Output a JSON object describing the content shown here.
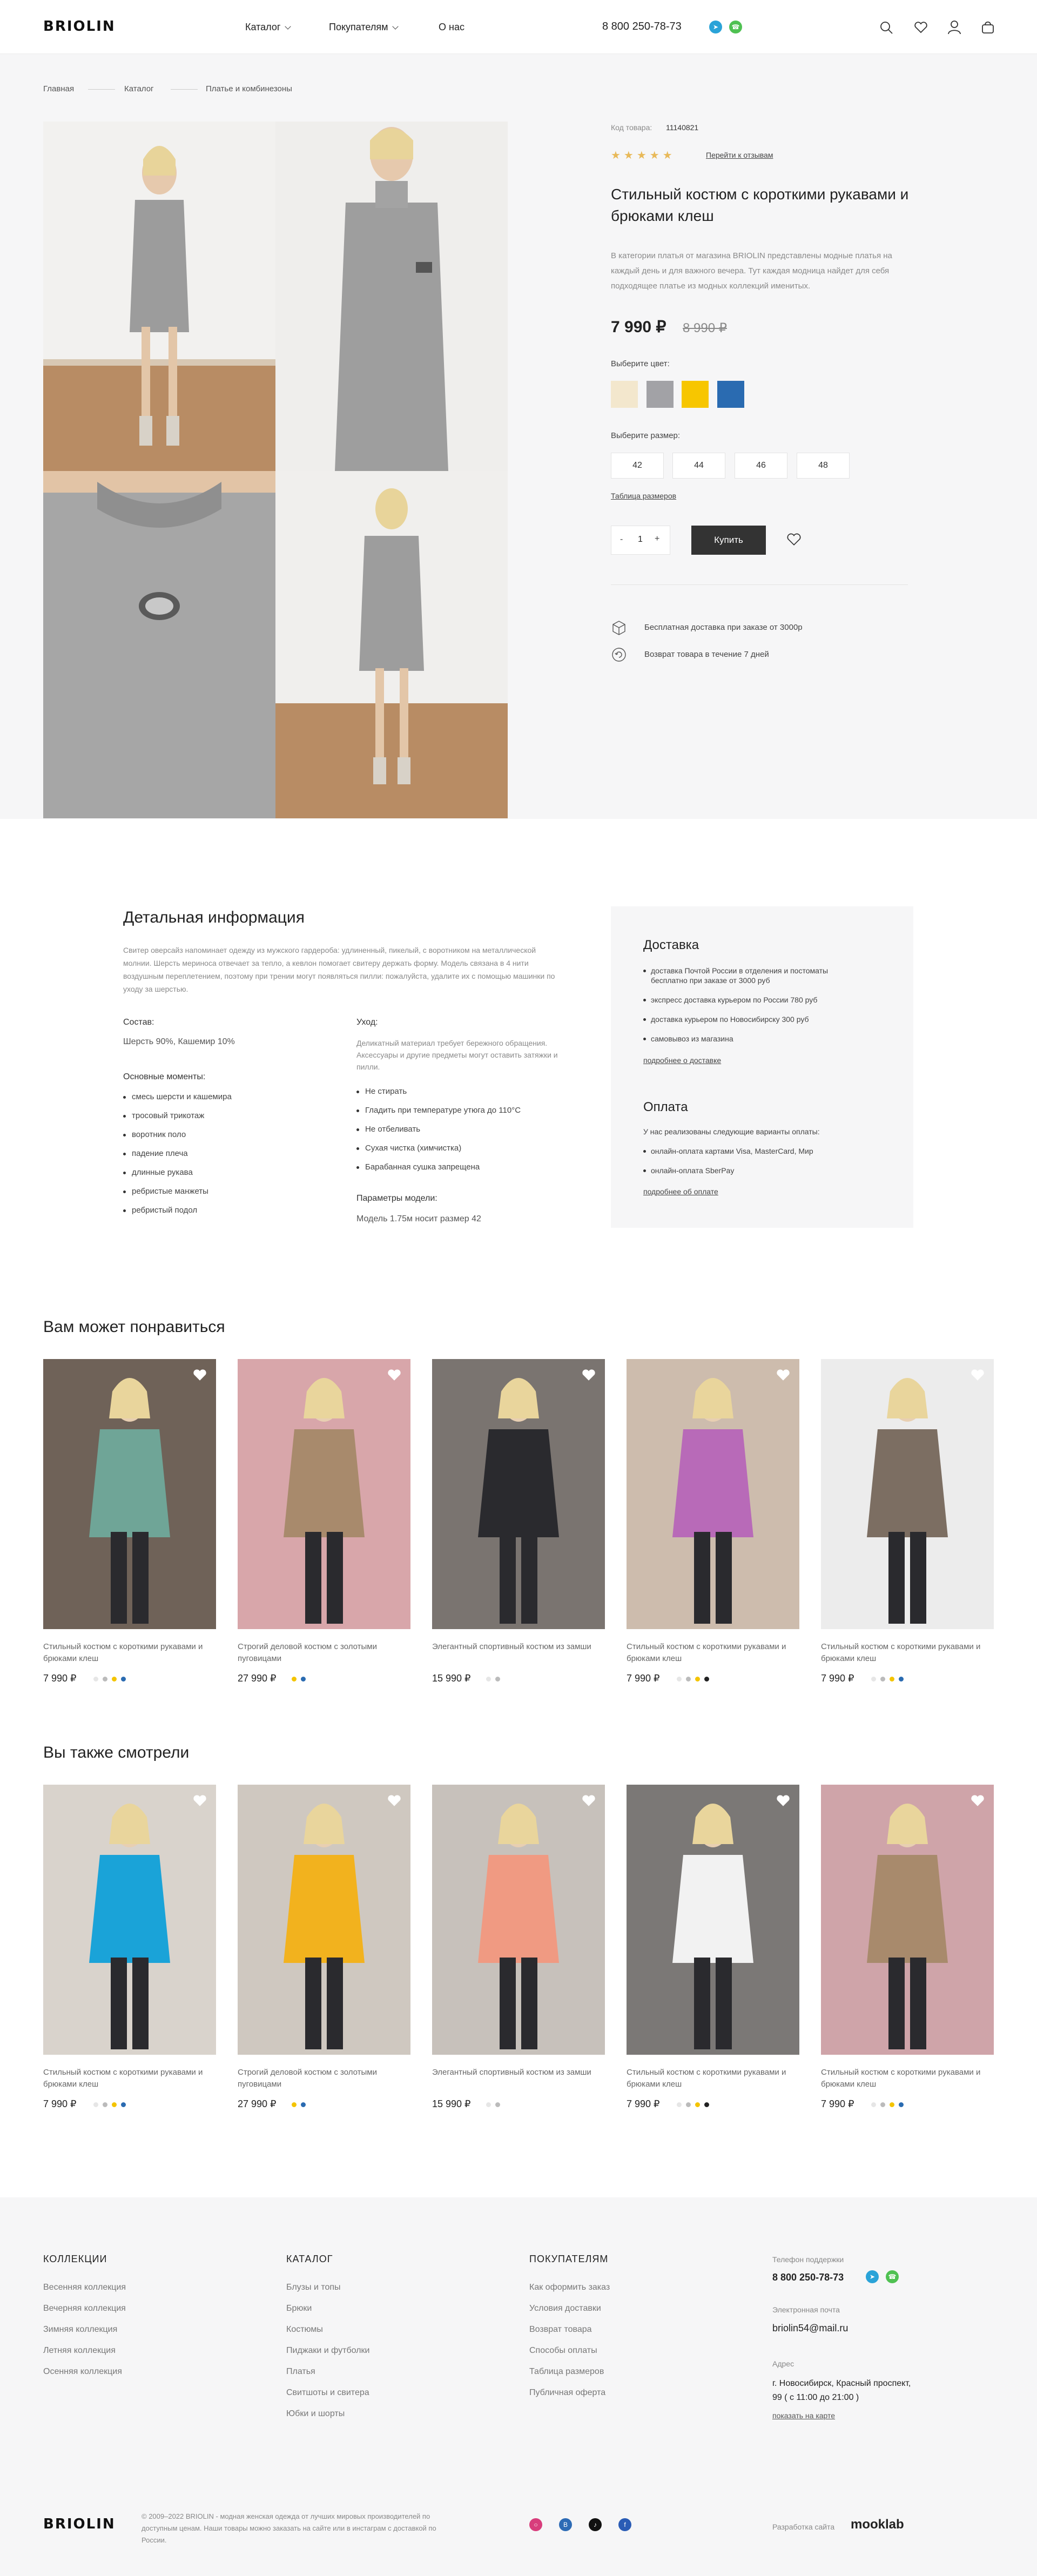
{
  "header": {
    "logo": "BRIOLIN",
    "nav": [
      "Каталог",
      "Покупателям",
      "О нас"
    ],
    "phone": "8 800 250-78-73"
  },
  "breadcrumbs": [
    "Главная",
    "Каталог",
    "Платье и комбинезоны"
  ],
  "product": {
    "code_label": "Код товара:",
    "code": "11140821",
    "reviews_link": "Перейти к отзывам",
    "rating": 5,
    "title": "Стильный костюм с короткими рукавами и брюками клеш",
    "description": "В категории платья от магазина BRIOLIN представлены модные платья на каждый день и для важного вечера. Тут каждая модница найдет для себя подходящее платье из модных коллекций именитых.",
    "price": "7 990 ₽",
    "old_price": "8 990 ₽",
    "color_label": "Выберите цвет:",
    "colors": [
      "#f3e7cd",
      "#a2a2a6",
      "#f7c600",
      "#2a6bb1"
    ],
    "size_label": "Выберите размер:",
    "sizes": [
      "42",
      "44",
      "46",
      "48"
    ],
    "size_table": "Таблица размеров",
    "qty": "1",
    "qty_minus": "-",
    "qty_plus": "+",
    "buy": "Купить",
    "perks": [
      "Бесплатная доставка при заказе от 3000р",
      "Возврат товара в течение 7 дней"
    ]
  },
  "details": {
    "title": "Детальная информация",
    "intro": "Свитер оверсайз напоминает одежду из мужского гардероба: удлиненный, пикелый, с воротником на металлической молнии. Шерсть мериноса отвечает за тепло, а кевлон помогает свитеру держать форму. Модель связана в 4 нити воздушным переплетением, поэтому при трении могут появляться пилли: пожалуйста, удалите их с помощью машинки по уходу за шерстью.",
    "composition_label": "Состав:",
    "composition": "Шерсть 90%, Кашемир 10%",
    "main_label": "Основные моменты:",
    "main_points": [
      "смесь шерсти и кашемира",
      "тросовый трикотаж",
      "воротник поло",
      "падение плеча",
      "длинные рукава",
      "ребристые манжеты",
      "ребристый подол"
    ],
    "care_label": "Уход:",
    "care_text": "Деликатный материал требует бережного обращения. Аксессуары и другие предметы могут оставить затяжки и пилли.",
    "care_points": [
      "Не стирать",
      "Гладить при температуре утюга до 110°C",
      "Не отбеливать",
      "Сухая чистка (химчистка)",
      "Барабанная сушка запрещена"
    ],
    "params_label": "Параметры модели:",
    "params": "Модель 1.75м носит размер 42"
  },
  "delivery": {
    "title": "Доставка",
    "items": [
      "доставка Почтой России в отделения и постоматы бесплатно при заказе от 3000 руб",
      "экспресс доставка курьером по России 780 руб",
      "доставка курьером по Новосибирску 300 руб",
      "самовывоз из магазина"
    ],
    "link": "подробнее о доставке",
    "pay_title": "Оплата",
    "pay_intro": "У нас реализованы следующие варианты оплаты:",
    "pay_items": [
      "онлайн-оплата картами Visa, MasterCard, Мир",
      "онлайн-оплата SberPay"
    ],
    "pay_link": "подробнее об оплате"
  },
  "related": {
    "title": "Вам может понравиться",
    "cards": [
      {
        "title": "Стильный костюм с короткими рукавами и брюками клеш",
        "price": "7 990 ₽",
        "dots": [
          "#e6e6e6",
          "#bbbbbb",
          "#f4c400",
          "#2a6bb1"
        ],
        "bg": "#6f6258",
        "cloth": "#6fa597"
      },
      {
        "title": "Строгий деловой костюм с золотыми пуговицами",
        "price": "27 990 ₽",
        "dots": [
          "#f4c400",
          "#2a6bb1"
        ],
        "bg": "#d8a6aa",
        "cloth": "#a88a6c"
      },
      {
        "title": "Элегантный спортивный костюм из замши",
        "price": "15 990 ₽",
        "dots": [
          "#e6e6e6",
          "#bbbbbb"
        ],
        "bg": "#7a7470",
        "cloth": "#2a2a2e"
      },
      {
        "title": "Стильный костюм с короткими рукавами и брюками клеш",
        "price": "7 990 ₽",
        "dots": [
          "#e6e6e6",
          "#bbbbbb",
          "#f4c400",
          "#222222"
        ],
        "bg": "#cdbcad",
        "cloth": "#b86ab8"
      },
      {
        "title": "Стильный костюм с короткими рукавами и брюками клеш",
        "price": "7 990 ₽",
        "dots": [
          "#e6e6e6",
          "#bbbbbb",
          "#f4c400",
          "#2a6bb1"
        ],
        "bg": "#ececec",
        "cloth": "#7c6e62"
      }
    ]
  },
  "viewed": {
    "title": "Вы также смотрели",
    "cards": [
      {
        "title": "Стильный костюм с короткими рукавами и брюками клеш",
        "price": "7 990 ₽",
        "dots": [
          "#e6e6e6",
          "#bbbbbb",
          "#f4c400",
          "#2a6bb1"
        ],
        "bg": "#d9d3cc",
        "cloth": "#1aa3d8"
      },
      {
        "title": "Строгий деловой костюм с золотыми пуговицами",
        "price": "27 990 ₽",
        "dots": [
          "#f4c400",
          "#2a6bb1"
        ],
        "bg": "#cfc8c0",
        "cloth": "#f2b21e"
      },
      {
        "title": "Элегантный спортивный костюм из замши",
        "price": "15 990 ₽",
        "dots": [
          "#e6e6e6",
          "#bbbbbb"
        ],
        "bg": "#c7c1bb",
        "cloth": "#f09a82"
      },
      {
        "title": "Стильный костюм с короткими рукавами и брюками клеш",
        "price": "7 990 ₽",
        "dots": [
          "#e6e6e6",
          "#bbbbbb",
          "#f4c400",
          "#222222"
        ],
        "bg": "#7b7876",
        "cloth": "#f2f2f2"
      },
      {
        "title": "Стильный костюм с короткими рукавами и брюками клеш",
        "price": "7 990 ₽",
        "dots": [
          "#e6e6e6",
          "#bbbbbb",
          "#f4c400",
          "#2a6bb1"
        ],
        "bg": "#cfa4a9",
        "cloth": "#a88a6c"
      }
    ]
  },
  "footer": {
    "collections_title": "КОЛЛЕКЦИИ",
    "collections": [
      "Весенняя коллекция",
      "Вечерняя коллекция",
      "Зимняя коллекция",
      "Летняя коллекция",
      "Осенняя коллекция"
    ],
    "catalog_title": "КАТАЛОГ",
    "catalog": [
      "Блузы и топы",
      "Брюки",
      "Костюмы",
      "Пиджаки и футболки",
      "Платья",
      "Свитшоты и свитера",
      "Юбки и шорты"
    ],
    "buyers_title": "ПОКУПАТЕЛЯМ",
    "buyers": [
      "Как оформить заказ",
      "Условия доставки",
      "Возврат товара",
      "Способы оплаты",
      "Таблица размеров",
      "Публичная оферта"
    ],
    "support_label": "Телефон поддержки",
    "support_phone": "8 800 250-78-73",
    "email_label": "Электронная почта",
    "email": "briolin54@mail.ru",
    "address_label": "Адрес",
    "address": "г. Новосибирск, Красный проспект, 99 ( с 11:00 до 21:00 )",
    "map_link": "показать на карте",
    "logo": "BRIOLIN",
    "copyright": "© 2009–2022 BRIOLIN - модная женская одежда от лучших мировых производителей по доступным ценам. Наши товары можно заказать на сайте или в инстаграм с доставкой по России.",
    "dev_label": "Разработка сайта",
    "dev_name": "mooklab"
  }
}
